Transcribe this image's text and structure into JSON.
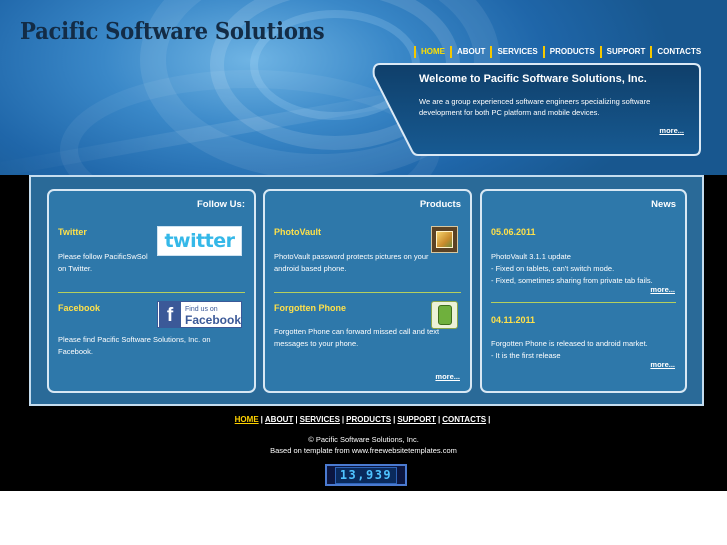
{
  "header": {
    "logo_text": "Pacific Software Solutions",
    "nav": [
      "HOME",
      "ABOUT",
      "SERVICES",
      "PRODUCTS",
      "SUPPORT",
      "CONTACTS"
    ],
    "active_nav": "HOME",
    "welcome": {
      "title": "Welcome to Pacific Software Solutions, Inc.",
      "text": "We are a group experienced software engineers specializing software development for both PC platform and mobile devices.",
      "more": "more..."
    }
  },
  "follow": {
    "title": "Follow Us:",
    "items": [
      {
        "title": "Twitter",
        "text": "Please follow PacificSwSol on Twitter.",
        "logo_text": "twitter"
      },
      {
        "title": "Facebook",
        "text": "Please find Pacific Software Solutions, Inc. on Facebook.",
        "logo_line1": "Find us on",
        "logo_line2": "Facebook"
      }
    ]
  },
  "products": {
    "title": "Products",
    "items": [
      {
        "title": "PhotoVault",
        "text": "PhotoVault password protects pictures on your android based phone."
      },
      {
        "title": "Forgotten Phone",
        "text": "Forgotten Phone can forward missed call and text messages to your phone."
      }
    ],
    "more": "more..."
  },
  "news": {
    "title": "News",
    "items": [
      {
        "date": "05.06.2011",
        "lines": [
          "PhotoVault 3.1.1 update",
          "- Fixed on tablets, can't switch mode.",
          "- Fixed, sometimes sharing from private tab fails."
        ],
        "more": "more..."
      },
      {
        "date": "04.11.2011",
        "lines": [
          "Forgotten Phone is released to android market.",
          "- It is the first release"
        ],
        "more": "more..."
      }
    ]
  },
  "footer": {
    "nav": [
      "HOME",
      "ABOUT",
      "SERVICES",
      "PRODUCTS",
      "SUPPORT",
      "CONTACTS"
    ],
    "copyright": "© Pacific Software Solutions, Inc.",
    "based_on": "Based on template from www.freewebsitetemplates.com",
    "counter": "13,939"
  },
  "colors": {
    "accent_yellow": "#ffe14a",
    "nav_separator": "#f5c800",
    "panel_blue": "#2e78aa",
    "header_blue": "#3a88c8"
  }
}
